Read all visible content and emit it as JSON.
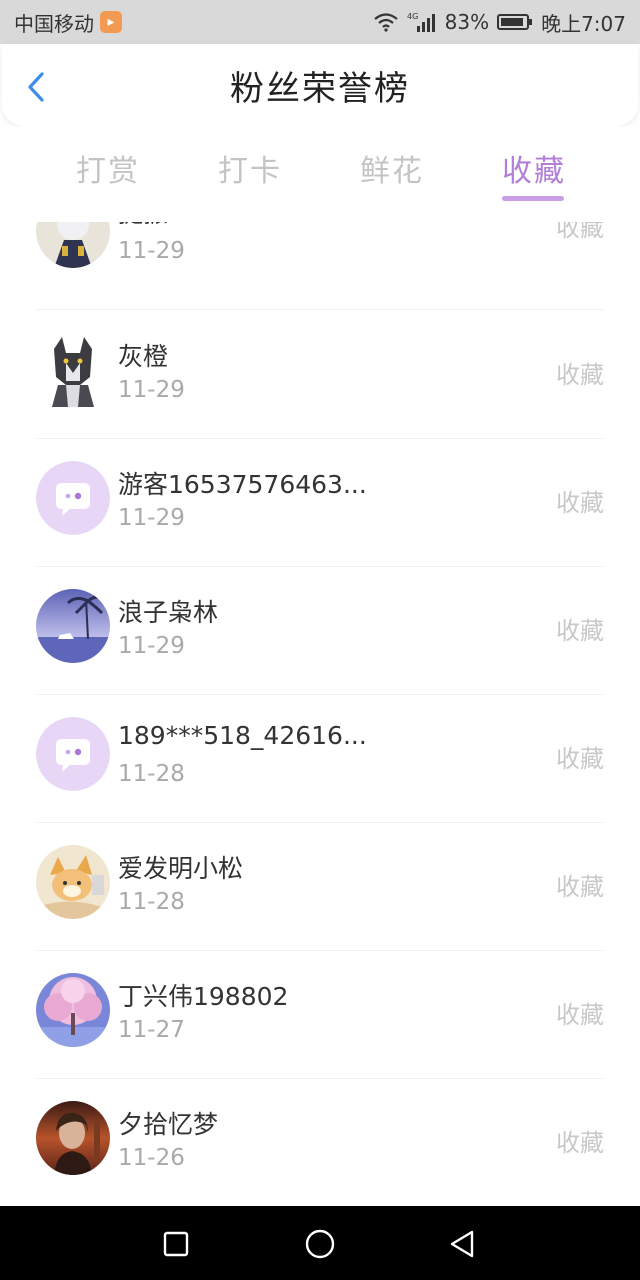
{
  "status_bar": {
    "carrier": "中国移动",
    "network": "4G",
    "battery": "83%",
    "time": "晚上7:07",
    "icons": [
      "wifi-icon",
      "signal-icon",
      "battery-icon"
    ]
  },
  "header": {
    "title": "粉丝荣誉榜",
    "back_icon": "chevron-left-icon"
  },
  "tabs": [
    {
      "label": "打赏",
      "active": false
    },
    {
      "label": "打卡",
      "active": false
    },
    {
      "label": "鲜花",
      "active": false
    },
    {
      "label": "收藏",
      "active": true
    }
  ],
  "colors": {
    "accent": "#b27ed8",
    "underline": "#c99ee8",
    "placeholder_avatar": "#e8d6f7"
  },
  "rows": [
    {
      "name": "提振",
      "date": "11-29",
      "action": "收藏",
      "avatar": "anime-fox-avatar"
    },
    {
      "name": "灰橙",
      "date": "11-29",
      "action": "收藏",
      "avatar": "wolf-avatar"
    },
    {
      "name": "游客16537576463...",
      "date": "11-29",
      "action": "收藏",
      "avatar": "default-chat-avatar"
    },
    {
      "name": "浪子枭林",
      "date": "11-29",
      "action": "收藏",
      "avatar": "beach-palm-avatar"
    },
    {
      "name": "189***518_42616...",
      "date": "11-28",
      "action": "收藏",
      "avatar": "default-chat-avatar"
    },
    {
      "name": "爱发明小松",
      "date": "11-28",
      "action": "收藏",
      "avatar": "anime-fox-avatar"
    },
    {
      "name": "丁兴伟198802",
      "date": "11-27",
      "action": "收藏",
      "avatar": "cherry-tree-avatar"
    },
    {
      "name": "夕拾忆梦",
      "date": "11-26",
      "action": "收藏",
      "avatar": "photo-avatar"
    }
  ],
  "nav": [
    "recent-apps-icon",
    "home-icon",
    "back-icon"
  ]
}
